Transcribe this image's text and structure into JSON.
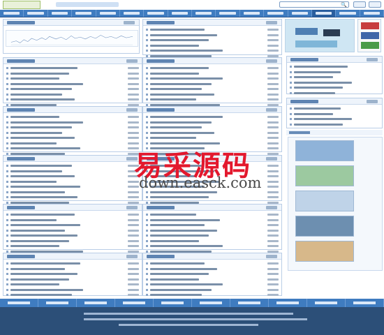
{
  "header": {
    "site_title": "",
    "search": {
      "value": "",
      "placeholder": "",
      "button_icon": "search-icon"
    },
    "login_label": "",
    "register_label": ""
  },
  "nav": {
    "items": [
      "",
      "",
      "",
      "",
      "",
      "",
      "",
      "",
      "",
      "",
      "",
      "",
      "",
      "",
      "",
      ""
    ],
    "active_index": 13
  },
  "sections": {
    "download_rank": {
      "title": "",
      "more": ""
    },
    "latest": {
      "title": "",
      "more": ""
    },
    "left_1": {
      "title": "",
      "more": ""
    },
    "right_1": {
      "title": "",
      "more": ""
    },
    "left_2": {
      "title": "",
      "more": ""
    },
    "right_2": {
      "title": "",
      "more": ""
    },
    "left_3": {
      "title": "",
      "more": ""
    },
    "right_3": {
      "title": "",
      "more": ""
    },
    "left_4": {
      "title": "",
      "more": ""
    },
    "right_4": {
      "title": "",
      "more": ""
    },
    "left_5": {
      "title": "",
      "more": ""
    },
    "right_5": {
      "title": "",
      "more": ""
    },
    "side_1": {
      "title": "",
      "more": ""
    },
    "side_2": {
      "title": "",
      "more": ""
    },
    "side_3": {
      "title": "",
      "more": ""
    }
  },
  "ads": {
    "banner_text": ""
  },
  "footer": {
    "links": [
      "",
      "",
      "",
      "",
      "",
      "",
      "",
      "",
      "",
      ""
    ],
    "copyright_lines": [
      "",
      "",
      ""
    ]
  },
  "watermark": {
    "chinese": "易采源码",
    "url": "down.easck.com"
  },
  "colors": {
    "nav": "#3f7cc0",
    "footer": "#2c4f78",
    "watermark": "#e3182d",
    "link": "#2e5f9a"
  }
}
